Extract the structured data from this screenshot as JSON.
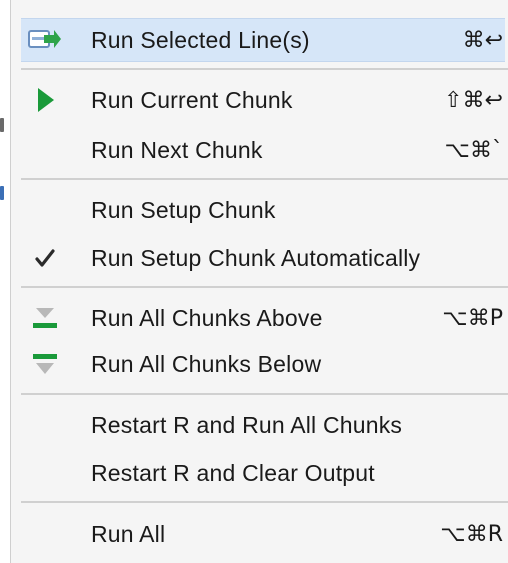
{
  "menu": {
    "items": [
      {
        "label": "Run Selected Line(s)",
        "shortcut": "⌘↩",
        "icon": "run-line-arrow-icon"
      },
      {
        "label": "Run Current Chunk",
        "shortcut": "⇧⌘↩",
        "icon": "play-triangle-icon"
      },
      {
        "label": "Run Next Chunk",
        "shortcut": "⌥⌘`",
        "icon": ""
      },
      {
        "label": "Run Setup Chunk",
        "shortcut": "",
        "icon": ""
      },
      {
        "label": "Run Setup Chunk Automatically",
        "shortcut": "",
        "icon": "checkmark-icon",
        "checked": true
      },
      {
        "label": "Run All Chunks Above",
        "shortcut": "⌥⌘P",
        "icon": "chunks-above-icon"
      },
      {
        "label": "Run All Chunks Below",
        "shortcut": "",
        "icon": "chunks-below-icon"
      },
      {
        "label": "Restart R and Run All Chunks",
        "shortcut": "",
        "icon": ""
      },
      {
        "label": "Restart R and Clear Output",
        "shortcut": "",
        "icon": ""
      },
      {
        "label": "Run All",
        "shortcut": "⌥⌘R",
        "icon": ""
      }
    ],
    "highlighted_index": 0
  },
  "colors": {
    "accent_green": "#1a9a3a",
    "highlight_bg": "#d6e6f8",
    "arrow_blue": "#3c86d6"
  }
}
